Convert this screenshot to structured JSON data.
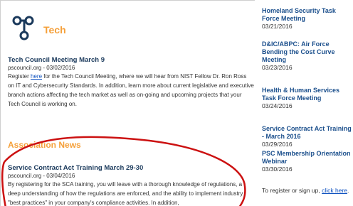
{
  "main": {
    "tech_title": "Tech",
    "article1": {
      "title": "Tech Council Meeting March 9",
      "meta": "pscouncil.org - 03/02/2016",
      "body_prefix": "Register ",
      "link": "here",
      "body_suffix": " for the Tech Council Meeting, where we will hear from NIST Fellow Dr. Ron Ross on IT and Cybersecurity Standards. In addition, learn more about current legislative and executive branch actions affecting the tech market as well as on-going and upcoming projects that your Tech Council is working on."
    },
    "association_title": "Association News",
    "article2": {
      "title": "Service Contract Act Training March 29-30",
      "meta": "pscouncil.org - 03/04/2016",
      "body": "By registering for the SCA training, you will leave with a thorough knowledge of regulations, a deep understanding of how the regulations are enforced, and the ability to implement industry \"best practices\" in your company's compliance activities. In addition,"
    }
  },
  "sidebar": {
    "items": [
      {
        "title": "Homeland Security Task Force Meeting",
        "date": "03/21/2016"
      },
      {
        "title": "D&IC/ABPC: Air Force Bending the Cost Curve Meeting",
        "date": "03/23/2016"
      },
      {
        "title": "Health & Human Services Task Force Meeting",
        "date": "03/24/2016"
      },
      {
        "title": "Service Contract Act Training - March 2016",
        "date": "03/29/2016"
      },
      {
        "title": "PSC Membership Orientation Webinar",
        "date": "03/30/2016"
      }
    ],
    "register_prefix": "To register or sign up, ",
    "register_link": "click here",
    "register_suffix": "."
  },
  "colors": {
    "accent_orange": "#f5a03a",
    "title_navy": "#1b3a5c",
    "link_blue": "#0b4fbf",
    "annotation_red": "#cc1111"
  }
}
